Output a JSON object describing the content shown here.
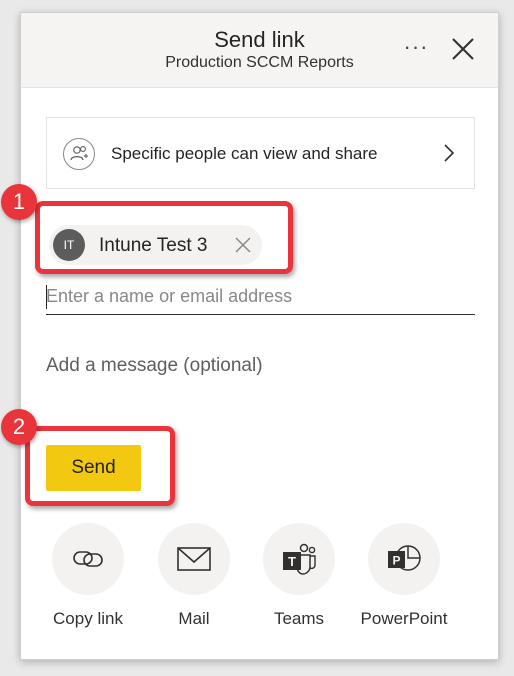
{
  "header": {
    "title": "Send link",
    "subtitle": "Production SCCM Reports",
    "more_icon": "more-horizontal-icon",
    "close_icon": "close-icon"
  },
  "permission": {
    "label": "Specific people can view and share",
    "icon": "people-icon"
  },
  "recipients": [
    {
      "initials": "IT",
      "name": "Intune Test 3"
    }
  ],
  "name_input": {
    "placeholder": "Enter a name or email address",
    "value": ""
  },
  "message_input": {
    "placeholder": "Add a message (optional)",
    "value": ""
  },
  "send_button": {
    "label": "Send"
  },
  "share_options": [
    {
      "label": "Copy link",
      "icon": "link-icon"
    },
    {
      "label": "Mail",
      "icon": "mail-icon"
    },
    {
      "label": "Teams",
      "icon": "teams-icon"
    },
    {
      "label": "PowerPoint",
      "icon": "powerpoint-icon"
    }
  ],
  "annotations": [
    {
      "number": "1"
    },
    {
      "number": "2"
    }
  ],
  "colors": {
    "accent": "#f2c811",
    "annotation": "#e8343a",
    "header_bg": "#f6f4f2"
  }
}
